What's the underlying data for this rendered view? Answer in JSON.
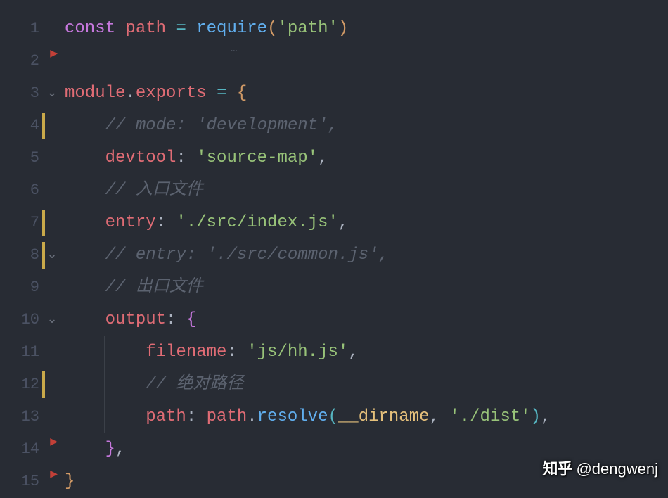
{
  "lines": [
    {
      "num": "1",
      "fold": "",
      "mod": false,
      "redArrow": true,
      "dotsUnder": true,
      "tokens": [
        {
          "cls": "tok-keyword",
          "text": "const"
        },
        {
          "cls": "tok-punct",
          "text": " "
        },
        {
          "cls": "tok-variable",
          "text": "path"
        },
        {
          "cls": "tok-punct",
          "text": " "
        },
        {
          "cls": "tok-operator",
          "text": "="
        },
        {
          "cls": "tok-punct",
          "text": " "
        },
        {
          "cls": "tok-function",
          "text": "require"
        },
        {
          "cls": "tok-brace",
          "text": "("
        },
        {
          "cls": "tok-string",
          "text": "'path'"
        },
        {
          "cls": "tok-brace",
          "text": ")"
        }
      ]
    },
    {
      "num": "2",
      "fold": "",
      "mod": false,
      "tokens": []
    },
    {
      "num": "3",
      "fold": "⌄",
      "mod": false,
      "tokens": [
        {
          "cls": "tok-variable",
          "text": "module"
        },
        {
          "cls": "tok-punct",
          "text": "."
        },
        {
          "cls": "tok-property",
          "text": "exports"
        },
        {
          "cls": "tok-punct",
          "text": " "
        },
        {
          "cls": "tok-operator",
          "text": "="
        },
        {
          "cls": "tok-punct",
          "text": " "
        },
        {
          "cls": "tok-brace",
          "text": "{"
        }
      ]
    },
    {
      "num": "4",
      "fold": "",
      "mod": true,
      "indent": 1,
      "tokens": [
        {
          "cls": "tok-punct",
          "text": "    "
        },
        {
          "cls": "tok-comment",
          "text": "// mode: 'development',"
        }
      ]
    },
    {
      "num": "5",
      "fold": "",
      "mod": false,
      "indent": 1,
      "tokens": [
        {
          "cls": "tok-punct",
          "text": "    "
        },
        {
          "cls": "tok-property",
          "text": "devtool"
        },
        {
          "cls": "tok-punct",
          "text": ": "
        },
        {
          "cls": "tok-string",
          "text": "'source-map'"
        },
        {
          "cls": "tok-punct",
          "text": ","
        }
      ]
    },
    {
      "num": "6",
      "fold": "",
      "mod": false,
      "indent": 1,
      "tokens": [
        {
          "cls": "tok-punct",
          "text": "    "
        },
        {
          "cls": "tok-comment",
          "text": "// 入口文件"
        }
      ]
    },
    {
      "num": "7",
      "fold": "",
      "mod": true,
      "indent": 1,
      "tokens": [
        {
          "cls": "tok-punct",
          "text": "    "
        },
        {
          "cls": "tok-property",
          "text": "entry"
        },
        {
          "cls": "tok-punct",
          "text": ": "
        },
        {
          "cls": "tok-string",
          "text": "'./src/index.js'"
        },
        {
          "cls": "tok-punct",
          "text": ","
        }
      ]
    },
    {
      "num": "8",
      "fold": "⌄",
      "mod": true,
      "indent": 1,
      "tokens": [
        {
          "cls": "tok-punct",
          "text": "    "
        },
        {
          "cls": "tok-comment",
          "text": "// entry: './src/common.js',"
        }
      ]
    },
    {
      "num": "9",
      "fold": "",
      "mod": false,
      "indent": 1,
      "tokens": [
        {
          "cls": "tok-punct",
          "text": "    "
        },
        {
          "cls": "tok-comment",
          "text": "// 出口文件"
        }
      ]
    },
    {
      "num": "10",
      "fold": "⌄",
      "mod": false,
      "indent": 1,
      "tokens": [
        {
          "cls": "tok-punct",
          "text": "    "
        },
        {
          "cls": "tok-property",
          "text": "output"
        },
        {
          "cls": "tok-punct",
          "text": ": "
        },
        {
          "cls": "tok-brace2",
          "text": "{"
        }
      ]
    },
    {
      "num": "11",
      "fold": "",
      "mod": false,
      "indent": 2,
      "tokens": [
        {
          "cls": "tok-punct",
          "text": "        "
        },
        {
          "cls": "tok-property",
          "text": "filename"
        },
        {
          "cls": "tok-punct",
          "text": ": "
        },
        {
          "cls": "tok-string",
          "text": "'js/hh.js'"
        },
        {
          "cls": "tok-punct",
          "text": ","
        }
      ]
    },
    {
      "num": "12",
      "fold": "",
      "mod": true,
      "indent": 2,
      "tokens": [
        {
          "cls": "tok-punct",
          "text": "        "
        },
        {
          "cls": "tok-comment",
          "text": "// 绝对路径"
        }
      ]
    },
    {
      "num": "13",
      "fold": "",
      "mod": false,
      "redArrow": true,
      "indent": 2,
      "tokens": [
        {
          "cls": "tok-punct",
          "text": "        "
        },
        {
          "cls": "tok-property",
          "text": "path"
        },
        {
          "cls": "tok-punct",
          "text": ": "
        },
        {
          "cls": "tok-variable",
          "text": "path"
        },
        {
          "cls": "tok-punct",
          "text": "."
        },
        {
          "cls": "tok-function",
          "text": "resolve"
        },
        {
          "cls": "tok-brace3",
          "text": "("
        },
        {
          "cls": "tok-builtin",
          "text": "__dirname"
        },
        {
          "cls": "tok-punct",
          "text": ", "
        },
        {
          "cls": "tok-string",
          "text": "'./dist'"
        },
        {
          "cls": "tok-brace3",
          "text": ")"
        },
        {
          "cls": "tok-punct",
          "text": ","
        }
      ]
    },
    {
      "num": "14",
      "fold": "",
      "mod": false,
      "redArrow": true,
      "indent": 1,
      "tokens": [
        {
          "cls": "tok-punct",
          "text": "    "
        },
        {
          "cls": "tok-brace2",
          "text": "}"
        },
        {
          "cls": "tok-punct",
          "text": ","
        }
      ]
    },
    {
      "num": "15",
      "fold": "",
      "mod": false,
      "tokens": [
        {
          "cls": "tok-brace",
          "text": "}"
        }
      ]
    }
  ],
  "watermark": {
    "logo": "知乎",
    "handle": "@dengwenj"
  }
}
